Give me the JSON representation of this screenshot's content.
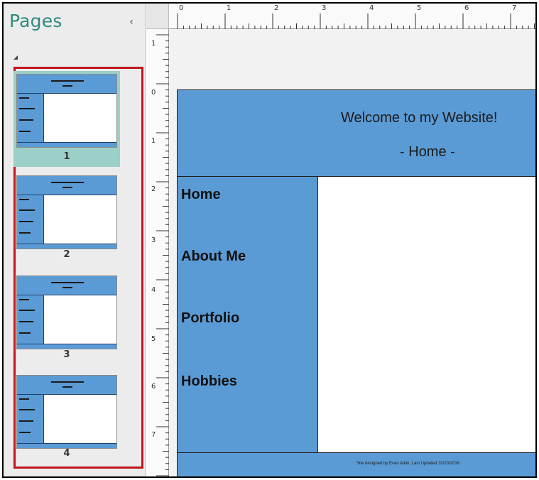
{
  "pages_panel": {
    "title": "Pages",
    "collapse_glyph": "‹",
    "pages": [
      {
        "number": "1",
        "selected": true
      },
      {
        "number": "2",
        "selected": false
      },
      {
        "number": "3",
        "selected": false
      },
      {
        "number": "4",
        "selected": false
      }
    ]
  },
  "rulers": {
    "horizontal": [
      "0",
      "1",
      "2",
      "3",
      "4",
      "5",
      "6",
      "7"
    ],
    "vertical": [
      "1",
      "0",
      "1",
      "2",
      "3",
      "4",
      "5",
      "6",
      "7"
    ]
  },
  "web_page": {
    "header_title": "Welcome to my Website!",
    "header_subtitle": "- Home -",
    "nav": [
      "Home",
      "About Me",
      "Portfolio",
      "Hobbies"
    ],
    "footer": "Site designed by Evan Atkin. Last Updated 10/20/2016"
  },
  "colors": {
    "header_blue": "#5b9bd5",
    "highlight_border": "#c0161c",
    "selected_page": "#9ccfc8",
    "panel_title": "#2f8a7f"
  },
  "icons": {
    "collapse": "chevron-left-icon",
    "expand": "triangle-icon"
  }
}
